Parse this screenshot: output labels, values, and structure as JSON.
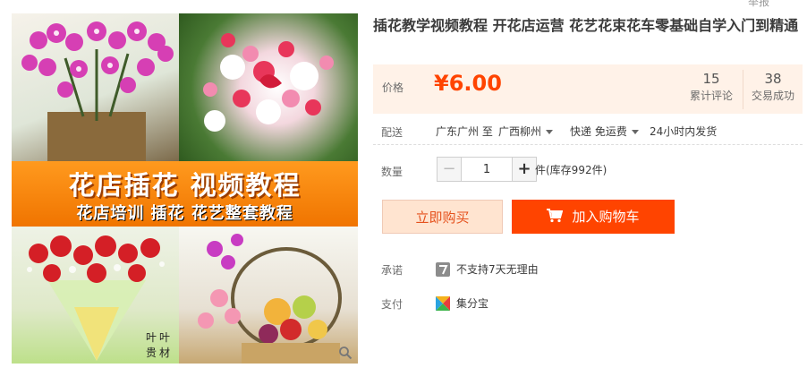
{
  "top_link": "举报",
  "gallery": {
    "banner_line1": "花店插花 视频教程",
    "banner_line2": "花店培训 插花 花艺整套教程",
    "watermark": "叶叶贵材"
  },
  "product": {
    "title": "插花教学视频教程 开花店运营 花艺花束花车零基础自学入门到精通"
  },
  "price": {
    "label": "价格",
    "value": "¥6.00",
    "color": "#ff4400"
  },
  "stats": {
    "reviews_count": "15",
    "reviews_label": "累计评论",
    "sales_count": "38",
    "sales_label": "交易成功"
  },
  "shipping": {
    "label": "配送",
    "origin": "广东广州 至",
    "destination": "广西柳州",
    "method": "快递 免运费",
    "dispatch": "24小时内发货"
  },
  "quantity": {
    "label": "数量",
    "minus_symbol": "−",
    "plus_symbol": "+",
    "value": "1",
    "stock": "件(库存992件)"
  },
  "actions": {
    "buy_now": "立即购买",
    "add_to_cart": "加入购物车",
    "accent": "#ff4400"
  },
  "promise": {
    "label": "承诺",
    "text": "不支持7天无理由",
    "icon": "no-7-day-return-icon"
  },
  "payment": {
    "label": "支付",
    "text": "集分宝",
    "icon": "jifenbao-icon"
  }
}
